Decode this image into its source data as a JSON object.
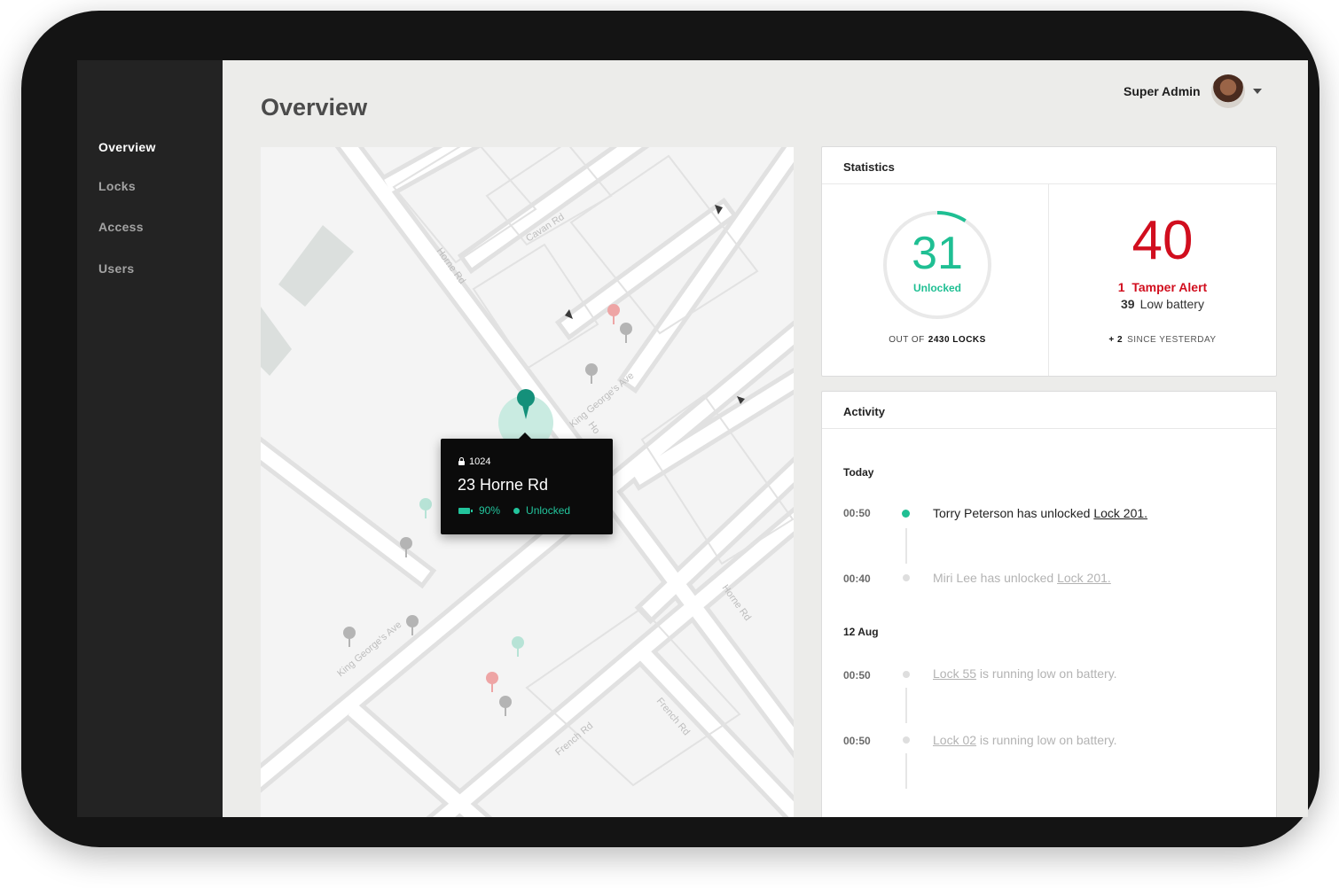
{
  "sidebar": {
    "items": [
      {
        "label": "Overview",
        "active": true
      },
      {
        "label": "Locks",
        "active": false
      },
      {
        "label": "Access",
        "active": false
      },
      {
        "label": "Users",
        "active": false
      }
    ]
  },
  "header": {
    "title": "Overview",
    "user_name": "Super Admin"
  },
  "map": {
    "street_labels": [
      "Cavan Rd",
      "Horne Rd",
      "King George's Ave",
      "Ho",
      "Horne Rd",
      "King George's Ave",
      "French Rd",
      "French Rd"
    ],
    "popup": {
      "lock_id": "1024",
      "address": "23 Horne Rd",
      "battery": "90%",
      "status": "Unlocked"
    }
  },
  "statistics": {
    "title": "Statistics",
    "unlocked_count": "31",
    "unlocked_label": "Unlocked",
    "unlocked_fraction": 0.0128,
    "out_of_prefix": "OUT OF",
    "out_of_total": "2430 LOCKS",
    "alerts_count": "40",
    "tamper_count": "1",
    "tamper_label": "Tamper Alert",
    "low_battery_count": "39",
    "low_battery_label": "Low battery",
    "delta": "+ 2",
    "delta_label": "SINCE YESTERDAY"
  },
  "activity": {
    "title": "Activity",
    "groups": [
      {
        "day": "Today",
        "events": [
          {
            "time": "00:50",
            "before": "Torry Peterson has unlocked ",
            "link": "Lock 201.",
            "after": "",
            "highlight": true
          },
          {
            "time": "00:40",
            "before": "Miri Lee has unlocked ",
            "link": "Lock 201.",
            "after": "",
            "highlight": false
          }
        ]
      },
      {
        "day": "12 Aug",
        "events": [
          {
            "time": "00:50",
            "before": "",
            "link": "Lock 55",
            "after": " is running low on battery.",
            "highlight": false
          },
          {
            "time": "00:50",
            "before": "",
            "link": "Lock 02",
            "after": " is running low on battery.",
            "highlight": false
          }
        ]
      }
    ]
  },
  "colors": {
    "accent_green": "#1fbf93",
    "alert_red": "#d10e1e",
    "sidebar_bg": "#232323"
  }
}
